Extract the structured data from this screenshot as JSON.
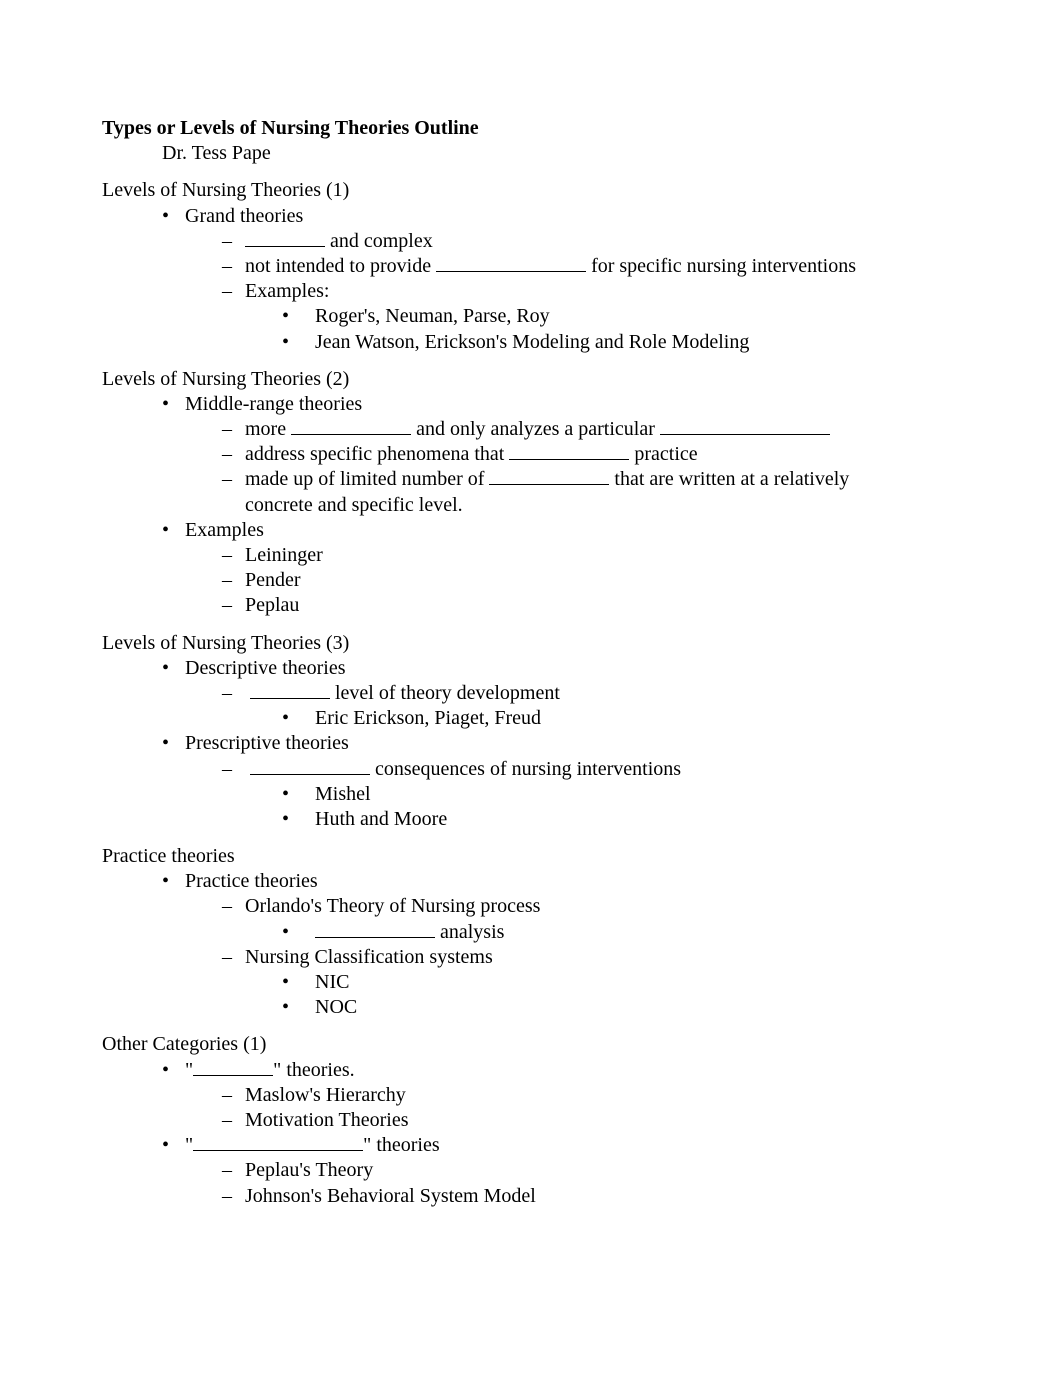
{
  "title": "Types or Levels of Nursing Theories Outline",
  "author": "Dr. Tess Pape",
  "s1": {
    "heading": "Levels of Nursing Theories (1)",
    "i0": "Grand theories",
    "l1b": " and complex",
    "l2a": "not intended to provide ",
    "l2b": " for specific nursing interventions",
    "ex": "Examples:",
    "ex1": "Roger's, Neuman, Parse, Roy",
    "ex2": "Jean Watson, Erickson's Modeling and Role Modeling"
  },
  "s2": {
    "heading": "Levels of Nursing Theories (2)",
    "i0": "Middle-range theories",
    "l1a": "more ",
    "l1b": " and only analyzes a particular ",
    "l2a": "address specific phenomena that ",
    "l2b": " practice",
    "l3a": "made up of limited number of ",
    "l3b": " that are written at a relatively",
    "l3c": "concrete and specific level.",
    "exh": "Examples",
    "ex1": "Leininger",
    "ex2": "Pender",
    "ex3": "Peplau"
  },
  "s3": {
    "heading": "Levels of Nursing Theories (3)",
    "d0": "Descriptive theories",
    "d1b": " level of theory development",
    "d2": "Eric Erickson, Piaget, Freud",
    "p0": "Prescriptive theories",
    "p1b": " consequences of nursing interventions",
    "p2": "Mishel",
    "p3": "Huth and Moore"
  },
  "s4": {
    "heading": "Practice theories",
    "i0": "Practice theories",
    "l1": "Orlando's Theory of Nursing process",
    "l1b": " analysis",
    "l2": "Nursing Classification systems",
    "l2a": "NIC",
    "l2b": "NOC"
  },
  "s5": {
    "heading": "Other Categories (1)",
    "q1a": "\"",
    "q1b": "\" theories.",
    "q1x1": "Maslow's Hierarchy",
    "q1x2": "Motivation Theories",
    "q2a": "\"",
    "q2b": "\" theories",
    "q2x1": "Peplau's Theory",
    "q2x2": "Johnson's Behavioral System Model"
  }
}
